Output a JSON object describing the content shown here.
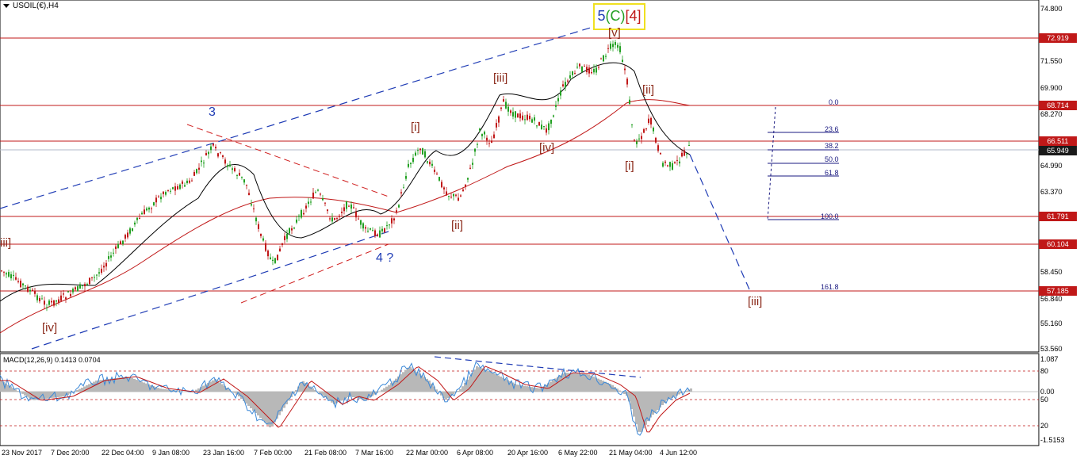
{
  "header": {
    "title": "USOIL(€),H4"
  },
  "macd": {
    "title": "MACD(12,26,9) 0.1413 0.0704"
  },
  "price_axis": [
    "74.800",
    "71.550",
    "69.900",
    "68.270",
    "64.990",
    "63.370",
    "60.100",
    "58.450",
    "56.840",
    "55.160",
    "53.560"
  ],
  "price_boxes": [
    {
      "label": "72.919",
      "color": "#c01818"
    },
    {
      "label": "68.714",
      "color": "#c01818"
    },
    {
      "label": "66.511",
      "color": "#c01818"
    },
    {
      "label": "65.949",
      "color": "#1a1a1a"
    },
    {
      "label": "61.791",
      "color": "#c01818"
    },
    {
      "label": "60.104",
      "color": "#c01818"
    },
    {
      "label": "57.185",
      "color": "#c01818"
    }
  ],
  "macd_axis": [
    "1.087",
    "80",
    "0.00",
    "50",
    "20",
    "-1.5153"
  ],
  "time_axis": [
    "23 Nov 2017",
    "7 Dec 20:00",
    "22 Dec 04:00",
    "9 Jan 08:00",
    "23 Jan 16:00",
    "7 Feb 00:00",
    "21 Feb 08:00",
    "7 Mar 16:00",
    "22 Mar 00:00",
    "6 Apr 08:00",
    "20 Apr 16:00",
    "6 May 22:00",
    "21 May 04:00",
    "4 Jun 12:00"
  ],
  "waves": {
    "top_5": "5",
    "top_c_open": "(",
    "top_c": "C",
    "top_c_close": ")",
    "top_4": "[4]",
    "v": "[v]",
    "iii_left": "[iii]",
    "iii_edge": "iii]",
    "i_top": "[i]",
    "ii_mid": "[ii]",
    "iv_mid": "[iv]",
    "i_low": "[i]",
    "ii_low": "[ii]",
    "iv_left": "[iv]",
    "three": "3",
    "four_q": "4 ?",
    "iii_target": "[iii]"
  },
  "fib_levels": [
    "0.0",
    "23.6",
    "38.2",
    "50.0",
    "61.8",
    "100.0",
    "161.8"
  ],
  "colors": {
    "resistance_line": "#c01818",
    "channel_blue": "#1f3cb5",
    "ma_red": "#c01818",
    "ma_black": "#000000",
    "candle_up": "#22a022",
    "candle_down": "#c01818",
    "macd_hist": "#b8b8b8",
    "macd_signal": "#3a88d8"
  }
}
